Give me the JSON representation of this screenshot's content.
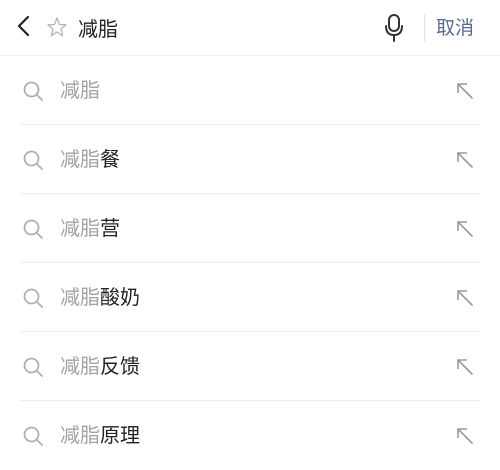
{
  "header": {
    "back_icon": "chevron-left-icon",
    "star_icon": "star-outline-icon",
    "query_value": "减脂",
    "mic_icon": "microphone-icon",
    "cancel_label": "取消",
    "accent_color": "#566b8f"
  },
  "suggestions": [
    {
      "query": "减脂",
      "rest": ""
    },
    {
      "query": "减脂",
      "rest": "餐"
    },
    {
      "query": "减脂",
      "rest": "营"
    },
    {
      "query": "减脂",
      "rest": "酸奶"
    },
    {
      "query": "减脂",
      "rest": "反馈"
    },
    {
      "query": "减脂",
      "rest": "原理"
    }
  ],
  "icons": {
    "row_left": "search-icon",
    "row_right": "fill-query-arrow-icon"
  }
}
